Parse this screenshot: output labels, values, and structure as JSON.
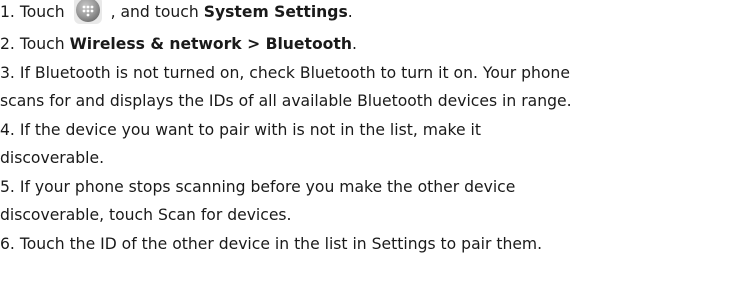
{
  "steps": [
    {
      "num": "1.",
      "pre": "Touch",
      "icon": "apps-launcher-icon",
      "mid": ", and touch",
      "bold": "System Settings",
      "post": "."
    },
    {
      "num": "2.",
      "pre": "Touch",
      "bold": "Wireless & network > Bluetooth",
      "post": "."
    },
    {
      "num": "3.",
      "line1": "If Bluetooth is not turned on, check Bluetooth to turn it on. Your phone",
      "line2": "scans for and displays the IDs of all available Bluetooth devices in range."
    },
    {
      "num": "4.",
      "line1": "If the device you want to pair with is not in the list, make it",
      "line2": "discoverable."
    },
    {
      "num": "5.",
      "line1": "If your phone stops scanning before you make the other device",
      "line2": "discoverable, touch Scan for devices."
    },
    {
      "num": "6.",
      "line1": "Touch the ID of the other device in the list in Settings to pair them."
    }
  ],
  "colors": {
    "text": "#1a1a1a",
    "icon_body": "#9a9a9a"
  }
}
